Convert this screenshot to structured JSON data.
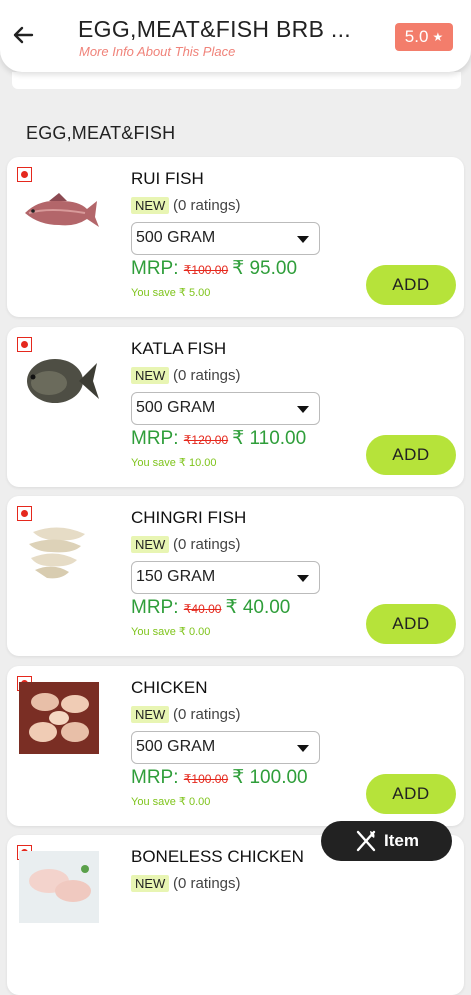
{
  "header": {
    "title": "EGG,MEAT&FISH BRB ...",
    "subtitle": "More Info About This Place",
    "rating": "5.0",
    "rating_star": "★"
  },
  "section_title": "EGG,MEAT&FISH",
  "items": [
    {
      "name": "RUI FISH",
      "tag": "NEW",
      "ratings": "(0 ratings)",
      "qty": "500 GRAM",
      "mrp_label": "MRP:",
      "old_price": "₹100.00",
      "price": "₹ 95.00",
      "save": "You save ₹ 5.00",
      "add": "ADD"
    },
    {
      "name": "KATLA FISH",
      "tag": "NEW",
      "ratings": "(0 ratings)",
      "qty": "500 GRAM",
      "mrp_label": "MRP:",
      "old_price": "₹120.00",
      "price": "₹ 110.00",
      "save": "You save ₹ 10.00",
      "add": "ADD"
    },
    {
      "name": "CHINGRI FISH",
      "tag": "NEW",
      "ratings": "(0 ratings)",
      "qty": "150 GRAM",
      "mrp_label": "MRP:",
      "old_price": "₹40.00",
      "price": "₹ 40.00",
      "save": "You save ₹ 0.00",
      "add": "ADD"
    },
    {
      "name": "CHICKEN",
      "tag": "NEW",
      "ratings": "(0 ratings)",
      "qty": "500 GRAM",
      "mrp_label": "MRP:",
      "old_price": "₹100.00",
      "price": "₹ 100.00",
      "save": "You save ₹ 0.00",
      "add": "ADD"
    },
    {
      "name": "BONELESS CHICKEN",
      "tag": "NEW",
      "ratings": "(0 ratings)"
    }
  ],
  "fab": {
    "label": "Item",
    "icon": "fork-knife-icon"
  },
  "colors": {
    "accent_green": "#b6e33a",
    "price_green": "#2f9e3a",
    "badge": "#f37d6b",
    "veg_red": "#e5281d"
  }
}
